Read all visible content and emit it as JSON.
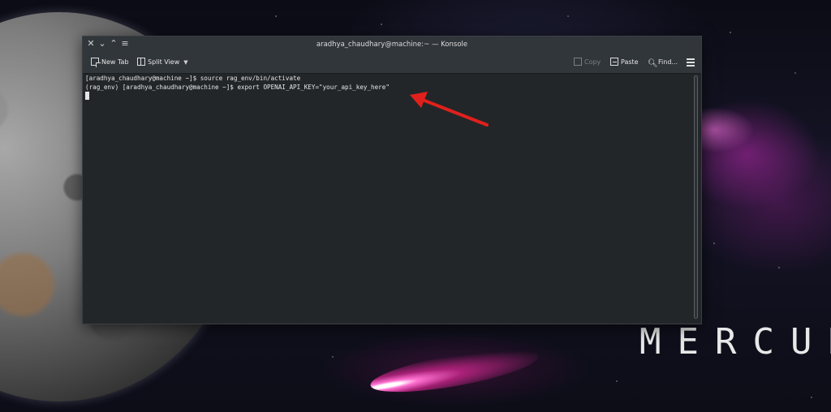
{
  "wallpaper": {
    "title": "MERCURY"
  },
  "window": {
    "title": "aradhya_chaudhary@machine:~ — Konsole",
    "controls": {
      "close": "✕",
      "minimize": "⌄",
      "maximize": "⌃",
      "menu": "≡"
    }
  },
  "toolbar": {
    "new_tab_label": "New Tab",
    "split_view_label": "Split View",
    "copy_label": "Copy",
    "paste_label": "Paste",
    "find_label": "Find..."
  },
  "terminal": {
    "lines": [
      "[aradhya_chaudhary@machine ~]$ source rag_env/bin/activate",
      "(rag_env) [aradhya_chaudhary@machine ~]$ export OPENAI_API_KEY=\"your_api_key_here\""
    ]
  },
  "colors": {
    "window_bg": "#232629",
    "titlebar_bg": "#31363b",
    "text": "#e6e6e6",
    "annotation_arrow": "#e0201c"
  },
  "icons": {
    "new_tab": "new-tab-icon",
    "split_view": "split-view-icon",
    "copy": "copy-icon",
    "paste": "paste-icon",
    "find": "search-icon",
    "menu": "hamburger-icon"
  }
}
